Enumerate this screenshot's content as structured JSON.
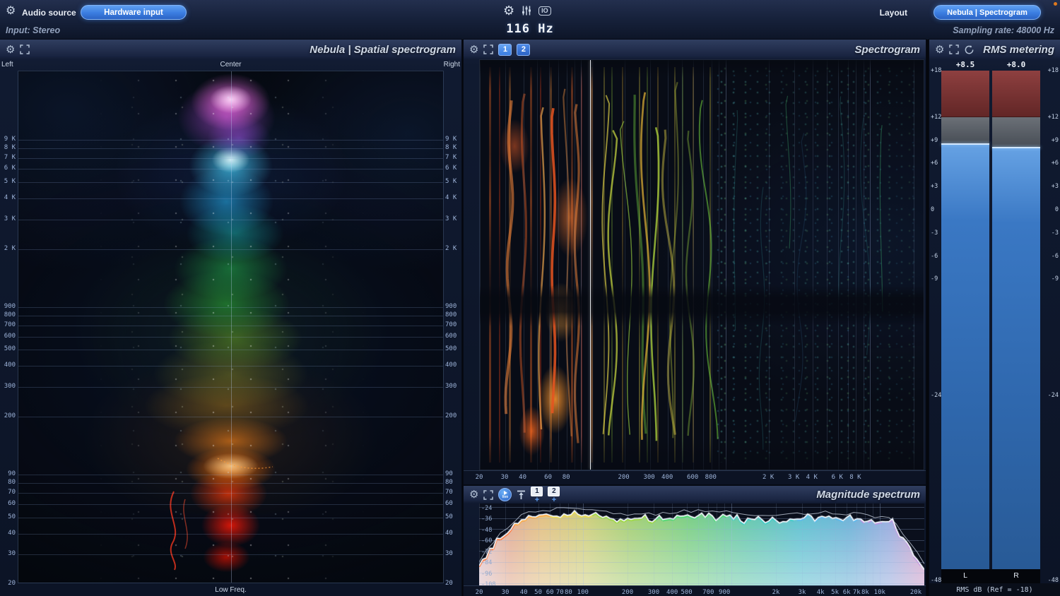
{
  "colors": {
    "accent_blue": "#4a8fe8",
    "meter_bar_blue": "#3a78c4",
    "meter_clip_red": "#7a3133",
    "status_dot_orange": "#e07a1e"
  },
  "topbar": {
    "audio_source_label": "Audio source",
    "hardware_input_button": "Hardware input",
    "io_icon_label": "IO",
    "center_freq_readout": "116 Hz",
    "layout_button": "Layout",
    "view_preset_button": "Nebula | Spectrogram",
    "input_label": "Input: Stereo",
    "sampling_rate_label": "Sampling rate: 48000 Hz"
  },
  "spatial_panel": {
    "title": "Nebula | Spatial spectrogram",
    "pan_left": "Left",
    "pan_center": "Center",
    "pan_right": "Right",
    "bottom_label": "Low Freq.",
    "freq_labels": [
      "9 K",
      "8 K",
      "7 K",
      "6 K",
      "5 K",
      "4 K",
      "3 K",
      "2 K",
      "900",
      "800",
      "700",
      "600",
      "500",
      "400",
      "300",
      "200",
      "90",
      "80",
      "70",
      "60",
      "50",
      "40",
      "30",
      "20"
    ]
  },
  "spectrogram_panel": {
    "title": "Spectrogram",
    "channel_buttons": [
      "1",
      "2"
    ],
    "cursor_freq_hz": 116,
    "freq_axis_labels": [
      "20",
      "30",
      "40",
      "60",
      "80",
      "200",
      "300",
      "400",
      "600",
      "800",
      "2 K",
      "3 K",
      "4 K",
      "6 K",
      "8 K"
    ]
  },
  "magnitude_panel": {
    "title": "Magnitude spectrum",
    "live_button_label": "live",
    "overlay_add_label": "+",
    "channel_buttons": [
      "1",
      "2"
    ],
    "db_axis_labels": [
      "-24",
      "-36",
      "-48",
      "-60",
      "-72",
      "-84",
      "-96",
      "-108"
    ],
    "freq_axis_labels": [
      "20",
      "30",
      "40",
      "50",
      "60",
      "70",
      "80",
      "100",
      "200",
      "300",
      "400",
      "500",
      "700",
      "900",
      "2k",
      "3k",
      "4k",
      "5k",
      "6k",
      "7k",
      "8k",
      "10k",
      "20k"
    ]
  },
  "rms_panel": {
    "title": "RMS metering",
    "left_value": "+8.5",
    "right_value": "+8.0",
    "scale_labels": [
      "+18",
      "+12",
      "+9",
      "+6",
      "+3",
      "0",
      "-3",
      "-6",
      "-9",
      "-24",
      "-48"
    ],
    "channel_labels": [
      "L",
      "R"
    ],
    "footer_label": "RMS dB (Ref = -18)"
  }
}
